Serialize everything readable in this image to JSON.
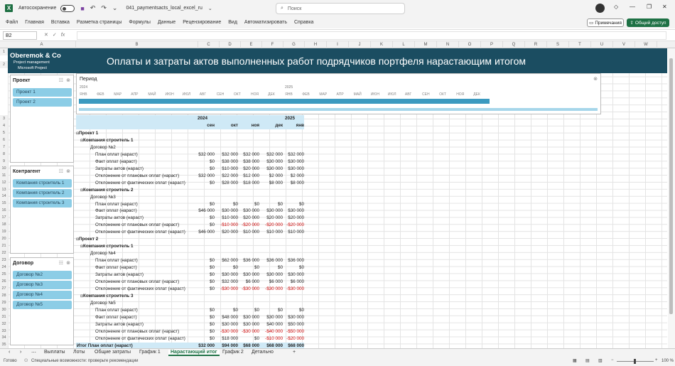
{
  "window": {
    "autosave_label": "Автосохранение",
    "filename": "041_paymentsacts_local_excel_ru",
    "search_placeholder": "Поиск"
  },
  "ribbon": {
    "tabs": [
      "Файл",
      "Главная",
      "Вставка",
      "Разметка страницы",
      "Формулы",
      "Данные",
      "Рецензирование",
      "Вид",
      "Автоматизировать",
      "Справка"
    ],
    "notes_label": "Примечания",
    "share_label": "Общий доступ"
  },
  "formula_bar": {
    "cell_ref": "B2",
    "fx": "fx",
    "value": ""
  },
  "columns": [
    "A",
    "B",
    "C",
    "D",
    "E",
    "F",
    "G",
    "H",
    "I",
    "J",
    "K",
    "L",
    "M",
    "N",
    "O",
    "P",
    "Q",
    "R",
    "S",
    "T",
    "U",
    "V",
    "W"
  ],
  "banner": {
    "company": "Oberemok & Co",
    "sub1": "Project management",
    "sub2": "Microsoft Project",
    "title": "Оплаты и затраты актов выполненных работ подрядчиков портфеля нарастающим итогом"
  },
  "slicers": [
    {
      "title": "Проект",
      "items": [
        "Проект 1",
        "Проект 2"
      ]
    },
    {
      "title": "Контрагент",
      "items": [
        "Компания строитель 1",
        "Компания строитель 2",
        "Компания строитель 3"
      ]
    },
    {
      "title": "Договор",
      "items": [
        "Договор №2",
        "Договор №3",
        "Договор №4",
        "Договор №5"
      ]
    }
  ],
  "timeline": {
    "title": "Период",
    "years": [
      "2024",
      "2025"
    ],
    "months": [
      "ЯНВ",
      "ФЕВ",
      "МАР",
      "АПР",
      "МАЙ",
      "ИЮН",
      "ИЮЛ",
      "АВГ",
      "СЕН",
      "ОКТ",
      "НОЯ",
      "ДЕК",
      "ЯНВ",
      "ФЕВ",
      "МАР",
      "АПР",
      "МАЙ",
      "ИЮН",
      "ИЮЛ",
      "АВГ",
      "СЕН",
      "ОКТ",
      "НОЯ",
      "ДЕК"
    ]
  },
  "pivot": {
    "year_2024": "2024",
    "year_2025": "2025",
    "months": [
      "сен",
      "окт",
      "ноя",
      "дек",
      "янв"
    ],
    "rows": [
      {
        "label": "Проект 1",
        "level": 0,
        "values": []
      },
      {
        "label": "Компания строитель 1",
        "level": 1,
        "values": []
      },
      {
        "label": "Договор №2",
        "level": 2,
        "values": []
      },
      {
        "label": "План оплат (нараст)",
        "level": 3,
        "values": [
          "$32 000",
          "$32 000",
          "$32 000",
          "$32 000",
          "$32 000"
        ]
      },
      {
        "label": "Факт оплат (нараст)",
        "level": 3,
        "values": [
          "$0",
          "$38 000",
          "$38 000",
          "$30 000",
          "$30 000"
        ]
      },
      {
        "label": "Затраты актов (нараст)",
        "level": 3,
        "values": [
          "$0",
          "$10 000",
          "$20 000",
          "$30 000",
          "$30 000"
        ]
      },
      {
        "label": "Отклонение от плановых оплат (нараст)",
        "level": 3,
        "values": [
          "$32 000",
          "$22 000",
          "$12 000",
          "$2 000",
          "$2 000"
        ]
      },
      {
        "label": "Отклонение от фактических оплат (нараст)",
        "level": 3,
        "values": [
          "$0",
          "$28 000",
          "$18 000",
          "$8 000",
          "$8 000"
        ]
      },
      {
        "label": "Компания строитель 2",
        "level": 1,
        "values": []
      },
      {
        "label": "Договор №3",
        "level": 2,
        "values": []
      },
      {
        "label": "План оплат (нараст)",
        "level": 3,
        "values": [
          "$0",
          "$0",
          "$0",
          "$0",
          "$0"
        ]
      },
      {
        "label": "Факт оплат (нараст)",
        "level": 3,
        "values": [
          "$46 000",
          "$30 000",
          "$30 000",
          "$30 000",
          "$30 000"
        ]
      },
      {
        "label": "Затраты актов (нараст)",
        "level": 3,
        "values": [
          "$0",
          "$10 000",
          "$20 000",
          "$20 000",
          "$20 000"
        ]
      },
      {
        "label": "Отклонение от плановых оплат (нараст)",
        "level": 3,
        "values": [
          "$0",
          "-$10 000",
          "-$20 000",
          "-$20 000",
          "-$20 000"
        ]
      },
      {
        "label": "Отклонение от фактических оплат (нараст)",
        "level": 3,
        "values": [
          "$46 000",
          "$20 000",
          "$10 000",
          "$10 000",
          "$10 000"
        ]
      },
      {
        "label": "Проект 2",
        "level": 0,
        "values": []
      },
      {
        "label": "Компания строитель 1",
        "level": 1,
        "values": []
      },
      {
        "label": "Договор №4",
        "level": 2,
        "values": []
      },
      {
        "label": "План оплат (нараст)",
        "level": 3,
        "values": [
          "$0",
          "$62 000",
          "$36 000",
          "$36 000",
          "$36 000"
        ]
      },
      {
        "label": "Факт оплат (нараст)",
        "level": 3,
        "values": [
          "$0",
          "$0",
          "$0",
          "$0",
          "$0"
        ]
      },
      {
        "label": "Затраты актов (нараст)",
        "level": 3,
        "values": [
          "$0",
          "$30 000",
          "$30 000",
          "$30 000",
          "$30 000"
        ]
      },
      {
        "label": "Отклонение от плановых оплат (нараст)",
        "level": 3,
        "values": [
          "$0",
          "$32 000",
          "$6 000",
          "$6 000",
          "$6 000"
        ]
      },
      {
        "label": "Отклонение от фактических оплат (нараст)",
        "level": 3,
        "values": [
          "$0",
          "-$30 000",
          "-$30 000",
          "-$30 000",
          "-$30 000"
        ]
      },
      {
        "label": "Компания строитель 3",
        "level": 1,
        "values": []
      },
      {
        "label": "Договор №5",
        "level": 2,
        "values": []
      },
      {
        "label": "План оплат (нараст)",
        "level": 3,
        "values": [
          "$0",
          "$0",
          "$0",
          "$0",
          "$0"
        ]
      },
      {
        "label": "Факт оплат (нараст)",
        "level": 3,
        "values": [
          "$0",
          "$48 000",
          "$30 000",
          "$30 000",
          "$30 000"
        ]
      },
      {
        "label": "Затраты актов (нараст)",
        "level": 3,
        "values": [
          "$0",
          "$30 000",
          "$30 000",
          "$40 000",
          "$50 000"
        ]
      },
      {
        "label": "Отклонение от плановых оплат (нараст)",
        "level": 3,
        "values": [
          "$0",
          "-$30 000",
          "-$30 000",
          "-$40 000",
          "-$50 000"
        ]
      },
      {
        "label": "Отклонение от фактических оплат (нараст)",
        "level": 3,
        "values": [
          "$0",
          "$18 000",
          "$0",
          "-$10 000",
          "-$20 000"
        ]
      }
    ],
    "total": {
      "label": "Итог План оплат (нараст)",
      "values": [
        "$32 000",
        "$94 000",
        "$68 000",
        "$68 000",
        "$68 000"
      ]
    }
  },
  "row_numbers": [
    "1",
    "2",
    "3",
    "4",
    "5",
    "6",
    "7",
    "8",
    "9",
    "10",
    "11",
    "12",
    "13",
    "14",
    "15",
    "16",
    "17",
    "18",
    "19",
    "20",
    "21",
    "22",
    "23",
    "24",
    "25",
    "26",
    "27",
    "28",
    "29",
    "30",
    "31",
    "32",
    "33",
    "34",
    "35"
  ],
  "sheet_tabs": [
    "Выплаты",
    "Лоты",
    "Общие затраты",
    "График 1",
    "Нарастающий итог",
    "График 2",
    "Детально"
  ],
  "active_tab": "Нарастающий итог",
  "status": {
    "ready": "Готово",
    "accessibility": "Специальные возможности: проверьте рекомендации",
    "zoom": "100 %"
  }
}
